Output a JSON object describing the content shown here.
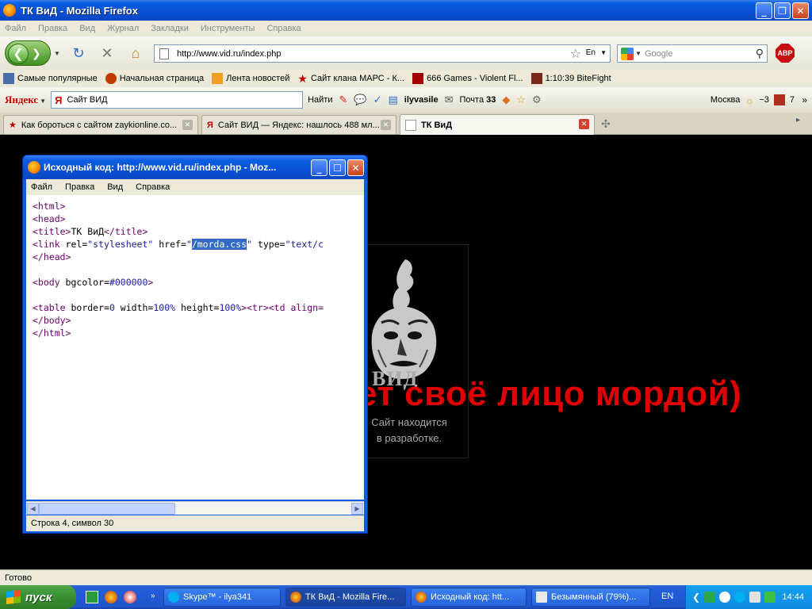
{
  "window": {
    "title": "ТК ВиД - Mozilla Firefox"
  },
  "menubar": [
    "Файл",
    "Правка",
    "Вид",
    "Журнал",
    "Закладки",
    "Инструменты",
    "Справка"
  ],
  "nav": {
    "url": "http://www.vid.ru/index.php",
    "search_placeholder": "Google",
    "abp_label": "ABP",
    "lang_icon": "En"
  },
  "bookmarks": [
    {
      "label": "Самые популярные",
      "icon": "bookmark-icon",
      "color": "#4a6ea9"
    },
    {
      "label": "Начальная страница",
      "icon": "firefox-icon",
      "color": "#c23a00"
    },
    {
      "label": "Лента новостей",
      "icon": "rss-icon",
      "color": "#f0a020"
    },
    {
      "label": "Сайт клана МАРС - К...",
      "icon": "star-icon",
      "color": "#c00000"
    },
    {
      "label": "666 Games - Violent Fl...",
      "icon": "games-icon",
      "color": "#a00000"
    },
    {
      "label": "1:10:39 BiteFight",
      "icon": "bitefight-icon",
      "color": "#7a2a1a"
    }
  ],
  "yandex": {
    "logo": "Яндекс",
    "search_value": "Сайт ВИД",
    "find_label": "Найти",
    "user": "ilyvasile",
    "mail_label": "Почта",
    "mail_count": "33",
    "city": "Москва",
    "temperature": "−3",
    "count": "7"
  },
  "tabs": [
    {
      "label": "Как бороться с сайтом zaykionline.co...",
      "active": false
    },
    {
      "label": "Сайт ВИД — Яндекс: нашлось 488 мл...",
      "active": false
    },
    {
      "label": "ТК ВиД",
      "active": true
    }
  ],
  "page": {
    "overlay_text": "ВИД называет своё лицо мордой)",
    "logo_text": "ВИД",
    "caption_line1": "Сайт находится",
    "caption_line2": "в разработке."
  },
  "source_window": {
    "title": "Исходный код: http://www.vid.ru/index.php - Moz...",
    "menu": [
      "Файл",
      "Правка",
      "Вид",
      "Справка"
    ],
    "status": "Строка 4, символ 30",
    "code": {
      "l1": "<html>",
      "l2": "<head>",
      "l3_open": "<title>",
      "l3_text": "ТК ВиД",
      "l3_close": "</title>",
      "l4_a": "<link ",
      "l4_rel_attr": "rel=",
      "l4_rel_val": "\"stylesheet\"",
      "l4_href_attr": " href=",
      "l4_q1": "\"",
      "l4_href_val": "/morda.css",
      "l4_q2": "\"",
      "l4_type_attr": " type=",
      "l4_type_val": "\"text/c",
      "l5": "</head>",
      "l7_tag": "<body ",
      "l7_attr": "bgcolor=",
      "l7_val": "#000000",
      "l7_end": ">",
      "l9_tag": "<table ",
      "l9_a1": "border=",
      "l9_v1": "0",
      "l9_a2": " width=",
      "l9_v2": "100%",
      "l9_a3": " height=",
      "l9_v3": "100%",
      "l9_rest": "><tr><td align=",
      "l10": "</body>",
      "l11": "</html>"
    }
  },
  "statusbar": {
    "text": "Готово"
  },
  "taskbar": {
    "start_label": "пуск",
    "tasks": [
      {
        "label": "Skype™ - ilya341"
      },
      {
        "label": "ТК ВиД - Mozilla Fire..."
      },
      {
        "label": "Исходный код: htt..."
      },
      {
        "label": "Безымянный (79%)..."
      }
    ],
    "lang": "EN",
    "clock": "14:44"
  }
}
